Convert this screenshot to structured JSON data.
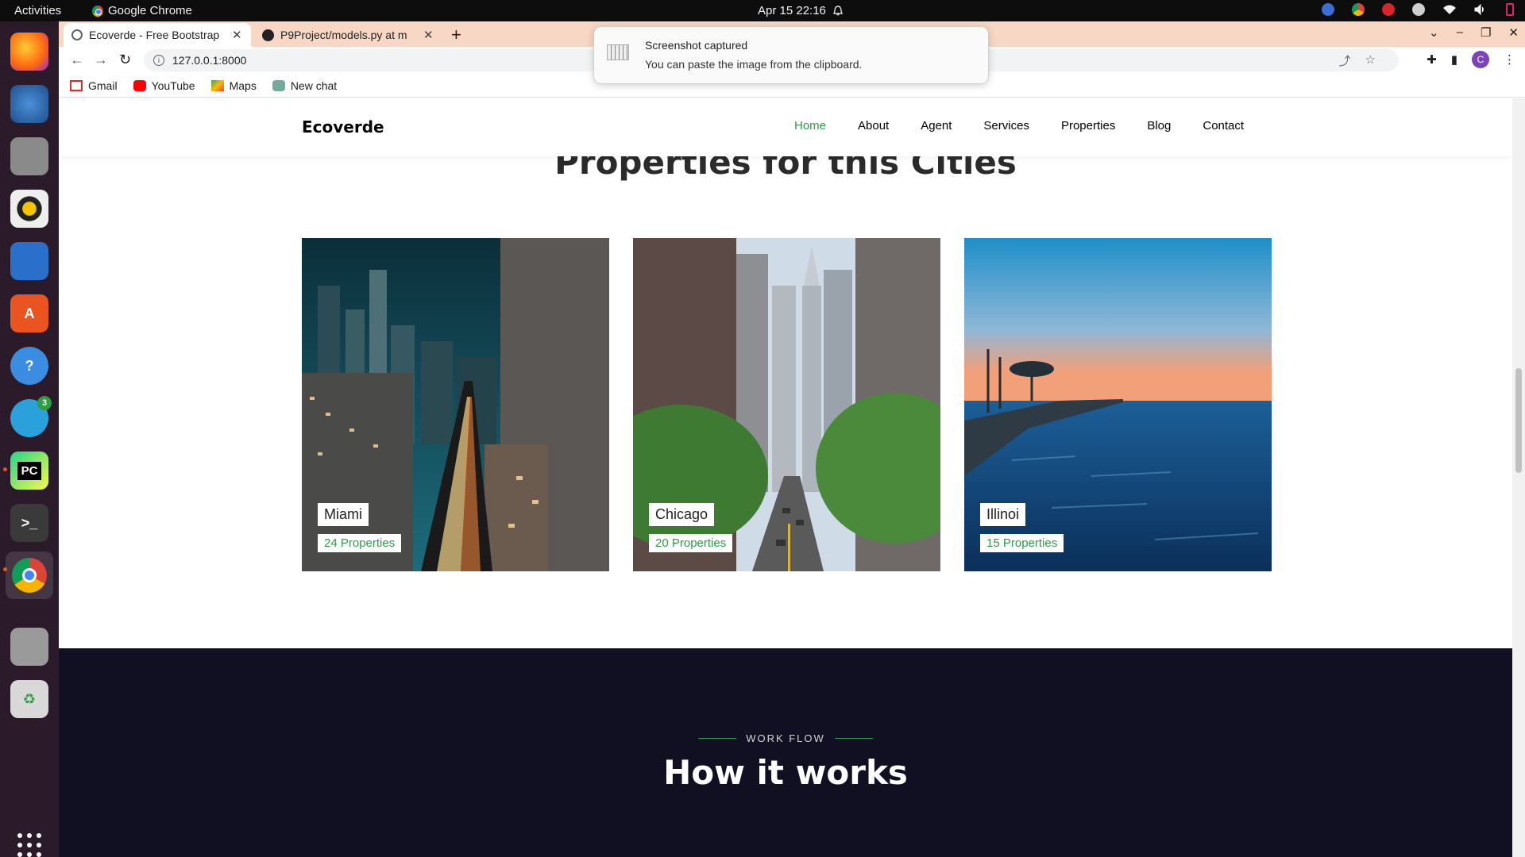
{
  "system": {
    "activities": "Activities",
    "app_name": "Google Chrome",
    "clock": "Apr 15  22:16"
  },
  "dock": {
    "telegram_badge": "3",
    "pycharm_label": "PC"
  },
  "browser": {
    "tabs": [
      {
        "title": "Ecoverde - Free Bootstrap"
      },
      {
        "title": "P9Project/models.py at m"
      }
    ],
    "new_tab": "+",
    "url": "127.0.0.1:8000",
    "profile_initial": "C",
    "bookmarks": [
      "Gmail",
      "YouTube",
      "Maps",
      "New chat"
    ]
  },
  "notification": {
    "title": "Screenshot captured",
    "body": "You can paste the image from the clipboard."
  },
  "site": {
    "brand": "Ecoverde",
    "nav": [
      "Home",
      "About",
      "Agent",
      "Services",
      "Properties",
      "Blog",
      "Contact"
    ],
    "active_nav": "Home",
    "section_title": "Properties for this Cities",
    "cities": [
      {
        "name": "Miami",
        "count": "24 Properties"
      },
      {
        "name": "Chicago",
        "count": "20 Properties"
      },
      {
        "name": "Illinoi",
        "count": "15 Properties"
      }
    ],
    "workflow_label": "WORK FLOW",
    "workflow_title": "How it works"
  },
  "colors": {
    "accent": "#2f9a4b",
    "dark_section": "#111022",
    "tab_strip": "#f8d7c4",
    "dock": "#2b1b2a"
  }
}
